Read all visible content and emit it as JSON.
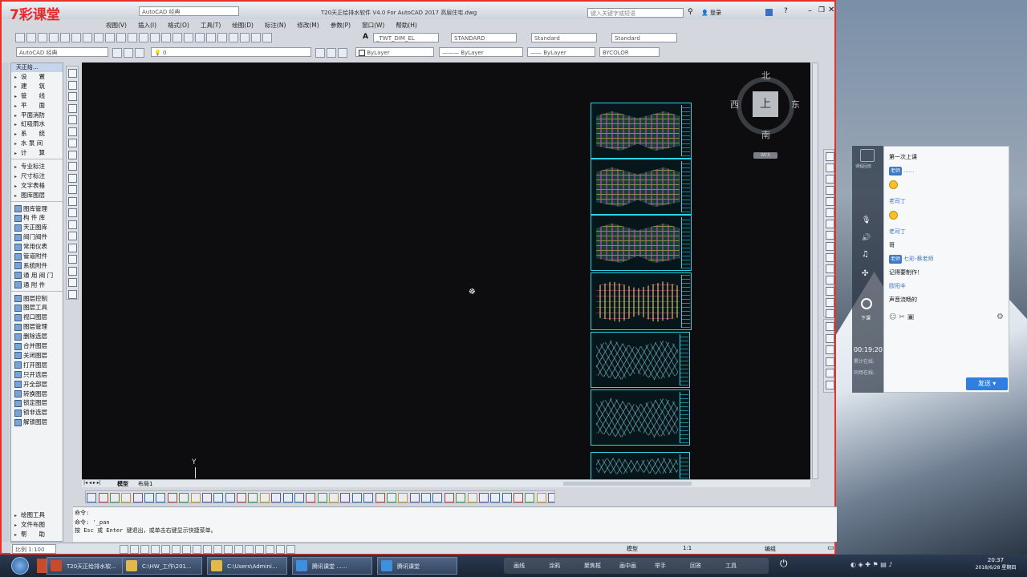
{
  "app": {
    "title": "T20天正给排水软件 V4.0 For AutoCAD 2017    高层住宅.dwg",
    "brand": "7彩课堂",
    "workspace": "AutoCAD 经典",
    "search_placeholder": "键入关键字或短语",
    "login": "登录"
  },
  "menu": [
    "视图(V)",
    "插入(I)",
    "格式(O)",
    "工具(T)",
    "绘图(D)",
    "标注(N)",
    "修改(M)",
    "参数(P)",
    "窗口(W)",
    "帮助(H)"
  ],
  "toolbar": {
    "text_style": "_TWT_DIM_EL",
    "dim_style": "STANDARD",
    "table_style": "Standard",
    "mleader_style": "Standard",
    "workspace_combo": "AutoCAD 经典",
    "layer": "0",
    "color": "ByLayer",
    "linetype": "ByLayer",
    "lineweight": "ByLayer",
    "plotstyle": "BYCOLOR"
  },
  "leftpanel": {
    "title": "天正给...",
    "groups": [
      {
        "items": [
          {
            "label": "设　　置",
            "arrow": true
          },
          {
            "label": "建　　筑",
            "arrow": true
          },
          {
            "label": "管　　线",
            "arrow": true
          },
          {
            "label": "平　　面",
            "arrow": true
          },
          {
            "label": "平面消防",
            "arrow": true
          },
          {
            "label": "虹吸雨水",
            "arrow": true
          },
          {
            "label": "系　　统",
            "arrow": true
          },
          {
            "label": "水 泵 间",
            "arrow": true
          },
          {
            "label": "计　　算",
            "arrow": true
          }
        ]
      },
      {
        "items": [
          {
            "label": "专业标注",
            "arrow": true
          },
          {
            "label": "尺寸标注",
            "arrow": true
          },
          {
            "label": "文字表格",
            "arrow": true
          },
          {
            "label": "图库图层",
            "arrow": true
          }
        ]
      },
      {
        "items": [
          {
            "label": "图库管理",
            "icon": true
          },
          {
            "label": "构 件 库",
            "icon": true
          },
          {
            "label": "天正图库",
            "icon": true
          },
          {
            "label": "阀门阀件",
            "icon": true
          },
          {
            "label": "常用仪表",
            "icon": true
          },
          {
            "label": "管道附件",
            "icon": true
          },
          {
            "label": "系统附件",
            "icon": true
          },
          {
            "label": "通 用 阀 门",
            "icon": true
          },
          {
            "label": "通 附 件",
            "icon": true
          }
        ]
      },
      {
        "items": [
          {
            "label": "图层控制",
            "icon": true
          },
          {
            "label": "图层工具",
            "icon": true
          },
          {
            "label": "视口图层",
            "icon": true
          },
          {
            "label": "图层管理",
            "icon": true
          },
          {
            "label": "删除选层",
            "icon": true
          },
          {
            "label": "合并图层",
            "icon": true
          },
          {
            "label": "关闭图层",
            "icon": true
          },
          {
            "label": "打开图层",
            "icon": true
          },
          {
            "label": "只开选层",
            "icon": true
          },
          {
            "label": "开全部层",
            "icon": true
          },
          {
            "label": "转换图层",
            "icon": true
          },
          {
            "label": "锁定图层",
            "icon": true
          },
          {
            "label": "锁非选层",
            "icon": true
          },
          {
            "label": "解锁图层",
            "icon": true
          }
        ]
      }
    ],
    "bottom": [
      {
        "label": "绘图工具"
      },
      {
        "label": "文件布图"
      },
      {
        "label": "帮　　助"
      }
    ]
  },
  "compass": {
    "n": "北",
    "s": "南",
    "e": "东",
    "w": "西",
    "center": "上",
    "wcs": "WCS"
  },
  "layout_tabs": [
    "模型",
    "布局1"
  ],
  "command": {
    "line1": "命令:",
    "line2": "命令: '_pan",
    "line3": "按 Esc 或 Enter 键退出，或单击右键显示快捷菜单。"
  },
  "status": {
    "scale": "比例 1:100",
    "model": "模型",
    "anno_scale": "1:1",
    "workspace": "编组"
  },
  "chat": {
    "messages": [
      {
        "type": "text",
        "text": "第一次上课"
      },
      {
        "type": "tagged",
        "tag": "老师",
        "nick": "......"
      },
      {
        "type": "emoji"
      },
      {
        "type": "nick",
        "nick": "老司丁"
      },
      {
        "type": "emoji"
      },
      {
        "type": "nick",
        "nick": "老司丁"
      },
      {
        "type": "text",
        "text": "哥"
      },
      {
        "type": "tagged",
        "tag": "老师",
        "nick": "七彩-蔡老师"
      },
      {
        "type": "text",
        "text": "记得要制作！"
      },
      {
        "type": "nick",
        "nick": "欧阳丰"
      },
      {
        "type": "text",
        "text": "声音流畅的"
      }
    ],
    "send": "发送",
    "time": "00:19:20",
    "side_label_1": "累计在线:",
    "side_label_2": "同场在线:",
    "side_top": "课程回放",
    "side_mic": "下课"
  },
  "taskbar": {
    "items": [
      {
        "label": "T20天正给排水软...",
        "color": "#c84b2b"
      },
      {
        "label": "C:\\HW_工作\\201...",
        "color": "#e2b84a"
      },
      {
        "label": "C:\\Users\\Admini...",
        "color": "#e2b84a"
      },
      {
        "label": "腾讯课堂 ......",
        "color": "#3f8fe0"
      },
      {
        "label": "腾讯课堂",
        "color": "#3f8fe0"
      }
    ],
    "tools": [
      "画线",
      "涂鸦",
      "聚焦框",
      "画中画",
      "举手",
      "回答",
      "工具"
    ],
    "clock_time": "20:37",
    "clock_date": "2018/6/28 星期四"
  }
}
